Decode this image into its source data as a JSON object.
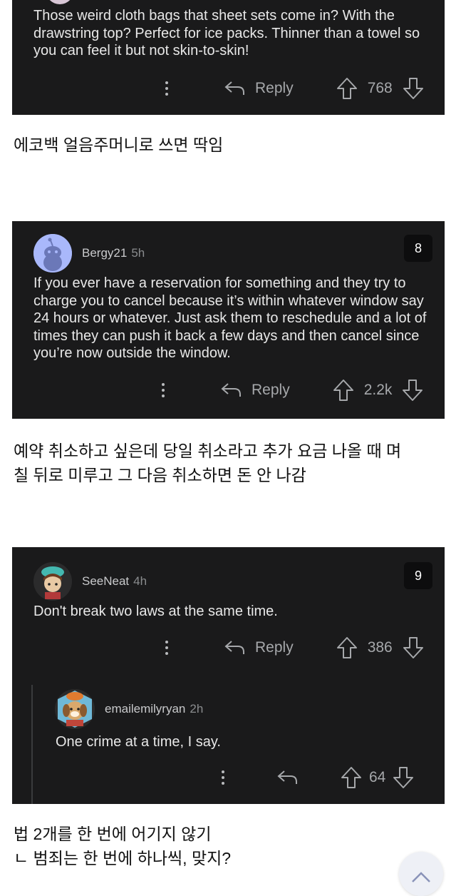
{
  "comments": [
    {
      "text": "Those weird cloth bags that sheet sets come in? With the drawstring top? Perfect for ice packs. Thinner than a towel so you can feel it but not skin-to-skin!",
      "reply_label": "Reply",
      "score": "768"
    },
    {
      "username": "Bergy21",
      "time": "5h",
      "rank": "8",
      "text": "If you ever have a reservation for something and they try to charge you to cancel because it’s within whatever window say 24 hours or whatever. Just ask them to reschedule and a lot of times they can push it back a few days and then cancel since you’re now outside the window.",
      "reply_label": "Reply",
      "score": "2.2k"
    },
    {
      "username": "SeeNeat",
      "time": "4h",
      "rank": "9",
      "text": "Don't break two laws at the same time.",
      "reply_label": "Reply",
      "score": "386",
      "reply": {
        "username": "emailemilyryan",
        "time": "2h",
        "text": "One crime at a time, I say.",
        "score": "64"
      }
    }
  ],
  "captions": [
    "에코백 얼음주머니로 쓰면 딱임",
    "예약 취소하고 싶은데 당일 취소라고 추가 요금 나올 때 며\n칠 뒤로 미루고 그 다음 취소하면 돈 안 나감",
    "법 2개를 한 번에 어기지 않기\nㄴ 범죄는 한 번에 하나씩, 맞지?"
  ],
  "colors": {
    "card_bg": "#1a1a1b",
    "page_bg": "#ffffff",
    "badge_bg": "#0d0d0e"
  }
}
